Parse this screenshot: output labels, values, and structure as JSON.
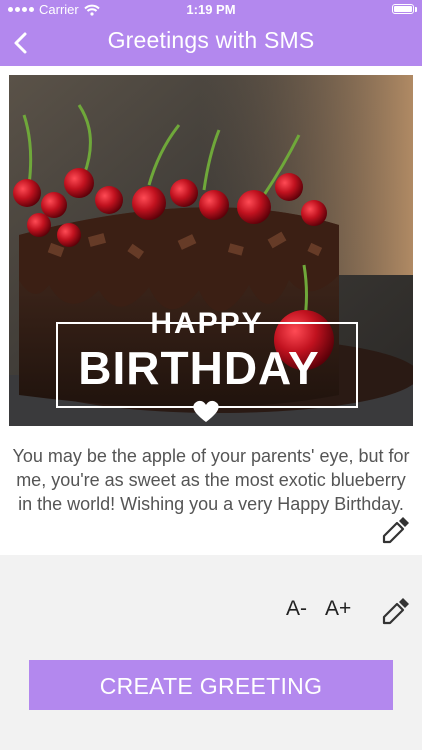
{
  "status_bar": {
    "carrier": "Carrier",
    "time": "1:19 PM"
  },
  "nav": {
    "title": "Greetings with SMS",
    "back_icon": "chevron-left-icon"
  },
  "card": {
    "image_description_icon": "birthday-cake-image",
    "line1": "HAPPY",
    "line2": "BIRTHDAY",
    "heart_icon": "heart-icon"
  },
  "message": "You may be the apple of your parents' eye, but for me, you're as sweet as the most exotic blueberry in the world! Wishing you a very Happy Birthday.",
  "controls": {
    "decrease": "A-",
    "increase": "A+",
    "color_picker_icon": "eyedropper-icon"
  },
  "action": {
    "create_label": "CREATE GREETING"
  },
  "colors": {
    "accent": "#b388ee",
    "text": "#555555"
  }
}
